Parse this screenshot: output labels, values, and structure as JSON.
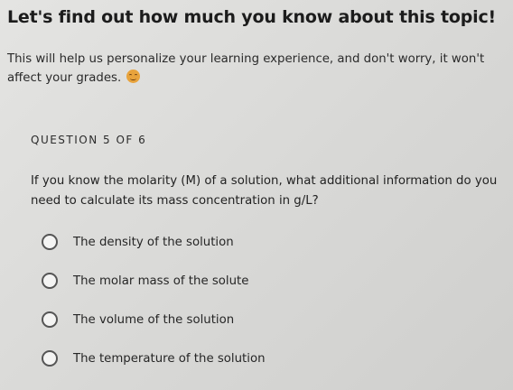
{
  "header": {
    "title": "Let's find out how much you know about this topic!",
    "intro_text": "This will help us personalize your learning experience, and don't worry, it won't affect your grades.",
    "emoji_icon": "grinning-face-icon"
  },
  "quiz": {
    "question_counter": "QUESTION 5 OF 6",
    "question_text": "If you know the molarity (M) of a solution, what additional information do you need to calculate its mass concentration in g/L?",
    "options": [
      {
        "label": "The density of the solution"
      },
      {
        "label": "The molar mass of the solute"
      },
      {
        "label": "The volume of the solution"
      },
      {
        "label": "The temperature of the solution"
      }
    ]
  }
}
